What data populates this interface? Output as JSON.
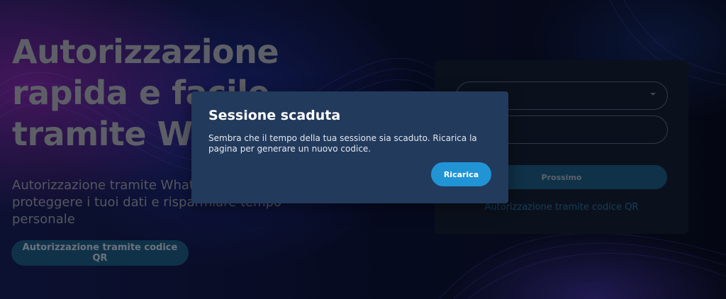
{
  "hero": {
    "title_lines": [
      "Autorizzazione",
      "rapida e facile",
      "tramite WhatsApp"
    ],
    "subtitle_lines": [
      "Autorizzazione tramite WhatsApp per",
      "proteggere i tuoi dati e risparmiare tempo",
      "personale"
    ],
    "qr_button_label": "Autorizzazione tramite codice QR"
  },
  "form": {
    "select_value": "",
    "phone_value": "",
    "next_button_label": "Prossimo",
    "qr_link_label": "Autorizzazione tramite codice QR"
  },
  "modal": {
    "title": "Sessione scaduta",
    "message_lines": [
      "Sembra che il tempo della tua sessione sia scaduto. Ricarica la",
      "pagina per generare un nuovo codice."
    ],
    "reload_button_label": "Ricarica"
  },
  "colors": {
    "modal_background": "#223a5c",
    "primary_button": "#2194d6",
    "page_background": "#0b0f24"
  }
}
